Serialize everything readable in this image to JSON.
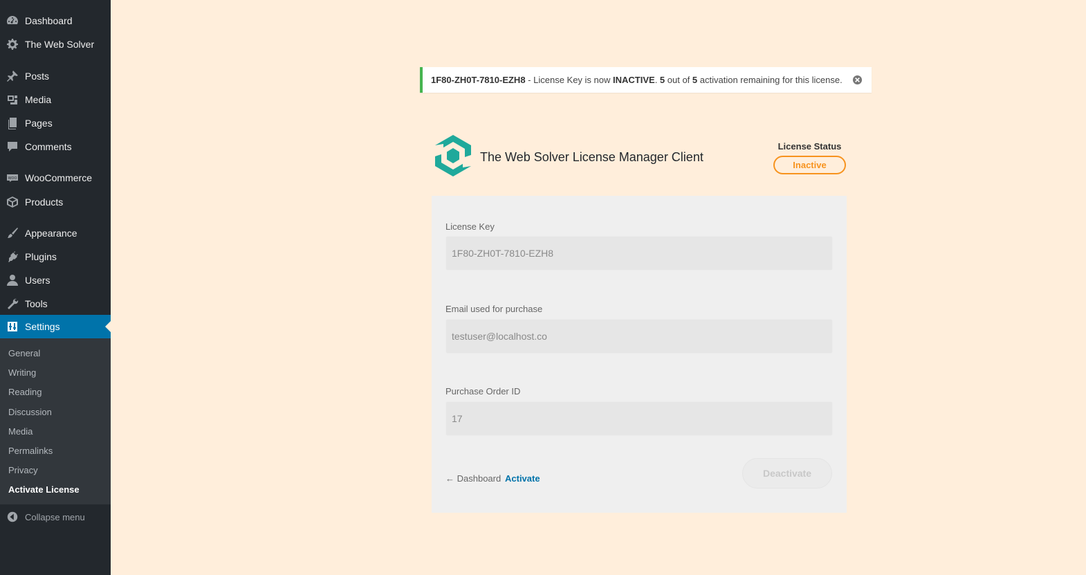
{
  "sidebar": {
    "items": [
      {
        "label": "Dashboard",
        "icon": "dashboard-icon"
      },
      {
        "label": "The Web Solver",
        "icon": "gear-icon"
      },
      {
        "label": "Posts",
        "icon": "pin-icon"
      },
      {
        "label": "Media",
        "icon": "media-icon"
      },
      {
        "label": "Pages",
        "icon": "pages-icon"
      },
      {
        "label": "Comments",
        "icon": "comment-icon"
      },
      {
        "label": "WooCommerce",
        "icon": "woocommerce-icon"
      },
      {
        "label": "Products",
        "icon": "box-icon"
      },
      {
        "label": "Appearance",
        "icon": "brush-icon"
      },
      {
        "label": "Plugins",
        "icon": "plug-icon"
      },
      {
        "label": "Users",
        "icon": "user-icon"
      },
      {
        "label": "Tools",
        "icon": "wrench-icon"
      },
      {
        "label": "Settings",
        "icon": "settings-icon",
        "current": true
      }
    ],
    "submenu": [
      "General",
      "Writing",
      "Reading",
      "Discussion",
      "Media",
      "Permalinks",
      "Privacy",
      "Activate License"
    ],
    "collapse_label": "Collapse menu"
  },
  "notice": {
    "key": "1F80-ZH0T-7810-EZH8",
    "text_1": " - License Key is now ",
    "status": "INACTIVE",
    "text_2": ". ",
    "remaining": "5",
    "text_3": " out of ",
    "total": "5",
    "text_4": " activation remaining for this license."
  },
  "header": {
    "title": "The Web Solver License Manager Client",
    "status_label": "License Status",
    "status_value": "Inactive"
  },
  "form": {
    "license_key_label": "License Key",
    "license_key_value": "1F80-ZH0T-7810-EZH8",
    "email_label": "Email used for purchase",
    "email_value": "testuser@localhost.co",
    "order_label": "Purchase Order ID",
    "order_value": "17",
    "back_label": "← Dashboard",
    "activate_label": "Activate",
    "deactivate_label": "Deactivate"
  },
  "colors": {
    "sidebar_bg": "#23282d",
    "accent": "#0073aa",
    "notice_border": "#46b450",
    "status_color": "#f7931e",
    "logo_color": "#1fa99b",
    "page_bg": "#ffeedb"
  }
}
